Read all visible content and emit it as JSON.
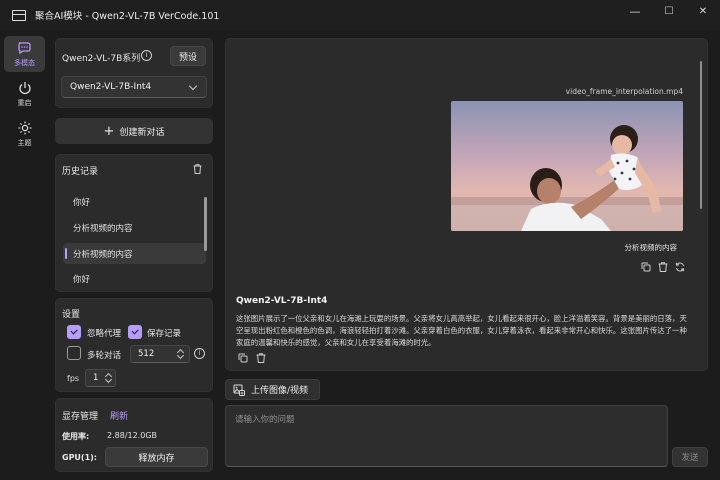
{
  "window": {
    "title": "聚合AI模块 - Qwen2-VL-7B VerCode.101",
    "controls": {
      "minimize": "—",
      "maximize": "☐",
      "close": "✕"
    }
  },
  "rail": {
    "items": [
      {
        "label": "多模态",
        "icon": "chat-bubbles-icon",
        "active": true
      },
      {
        "label": "重启",
        "icon": "power-icon",
        "active": false
      },
      {
        "label": "主题",
        "icon": "sun-icon",
        "active": false
      }
    ]
  },
  "model": {
    "series_title": "Qwen2-VL-7B系列",
    "preset_label": "预设",
    "selected": "Qwen2-VL-7B-Int4"
  },
  "new_chat_label": "创建新对话",
  "history": {
    "title": "历史记录",
    "items": [
      {
        "label": "你好",
        "active": false
      },
      {
        "label": "分析视频的内容",
        "active": false
      },
      {
        "label": "分析视频的内容",
        "active": true
      },
      {
        "label": "你好",
        "active": false
      }
    ]
  },
  "settings": {
    "title": "设置",
    "ignore_proxy": {
      "label": "忽略代理",
      "checked": true
    },
    "save_history": {
      "label": "保存记录",
      "checked": true
    },
    "multi_turn": {
      "label": "多轮对话",
      "checked": false,
      "value": "512"
    },
    "fps": {
      "label": "fps",
      "value": "1"
    }
  },
  "memory": {
    "title": "显存管理",
    "refresh_label": "刷新",
    "usage_label": "使用率:",
    "usage_value": "2.88/12.0GB",
    "gpu_label": "GPU(1):",
    "release_label": "释放内存"
  },
  "chat": {
    "user_attachment": "video_frame_interpolation.mp4",
    "user_message": "分析视频的内容",
    "assistant_name": "Qwen2-VL-7B-Int4",
    "assistant_message": "这张图片展示了一位父亲和女儿在海滩上玩耍的场景。父亲将女儿高高举起，女儿看起来很开心，脸上洋溢着笑容。背景是美丽的日落，天空呈现出粉红色和橙色的色调，海浪轻轻拍打着沙滩。父亲穿着白色的衣服，女儿穿着泳衣，看起来非常开心和快乐。这张图片传达了一种家庭的温馨和快乐的感觉，父亲和女儿在享受着海滩的时光。"
  },
  "composer": {
    "upload_label": "上传图像/视频",
    "placeholder": "请输入你的问题",
    "send_label": "发送"
  },
  "colors": {
    "accent": "#b79cff",
    "background": "#1c1c1c",
    "panel": "#2b2b2b"
  }
}
